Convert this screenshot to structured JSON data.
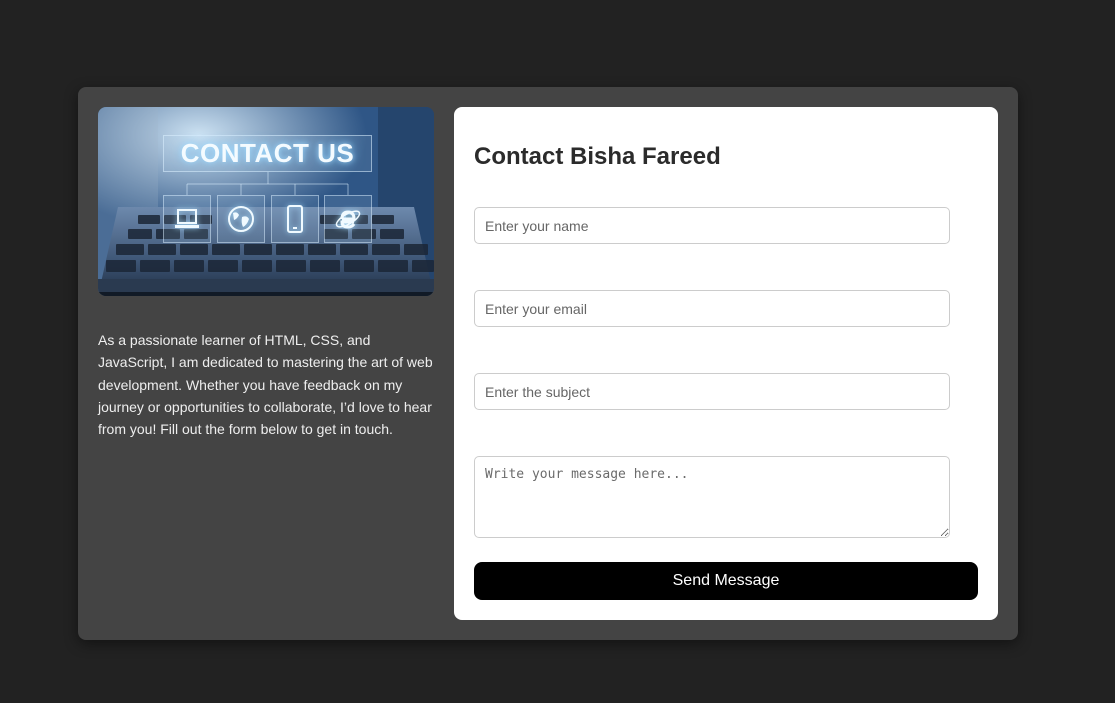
{
  "hero": {
    "image_text": "CONTACT US",
    "icons": [
      "laptop-icon",
      "globe-icon",
      "smartphone-icon",
      "internet-explorer-icon"
    ]
  },
  "about": {
    "text": "As a passionate learner of HTML, CSS, and JavaScript, I am dedicated to mastering the art of web development. Whether you have feedback on my journey or opportunities to collaborate, I’d love to hear from you! Fill out the form below to get in touch."
  },
  "form": {
    "title": "Contact Bisha Fareed",
    "name_placeholder": "Enter your name",
    "email_placeholder": "Enter your email",
    "subject_placeholder": "Enter the subject",
    "message_placeholder": "Write your message here...",
    "submit_label": "Send Message"
  },
  "colors": {
    "page_background": "#222222",
    "card_background": "#444444",
    "form_background": "#ffffff",
    "button_background": "#000000"
  }
}
